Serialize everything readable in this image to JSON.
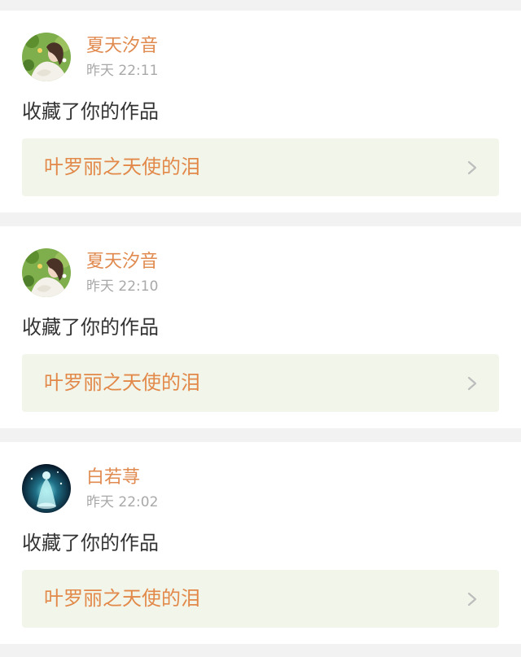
{
  "colors": {
    "page_background": "#f2f2f2",
    "card_background": "#ffffff",
    "username": "#e08a4f",
    "timestamp": "#a9a9a9",
    "action_text": "#333333",
    "work_link_background": "#f1f5ea",
    "work_title": "#e2894a",
    "chevron": "#bdbdbd"
  },
  "notifications": [
    {
      "avatar": "avatar-girl-flowers",
      "username": "夏天汐音",
      "time": "昨天 22:11",
      "action": "收藏了你的作品",
      "work_title": "叶罗丽之天使的泪",
      "chevron_icon": "chevron-right-icon"
    },
    {
      "avatar": "avatar-girl-flowers",
      "username": "夏天汐音",
      "time": "昨天 22:10",
      "action": "收藏了你的作品",
      "work_title": "叶罗丽之天使的泪",
      "chevron_icon": "chevron-right-icon"
    },
    {
      "avatar": "avatar-glowing-figure",
      "username": "白若荨",
      "time": "昨天 22:02",
      "action": "收藏了你的作品",
      "work_title": "叶罗丽之天使的泪",
      "chevron_icon": "chevron-right-icon"
    }
  ]
}
